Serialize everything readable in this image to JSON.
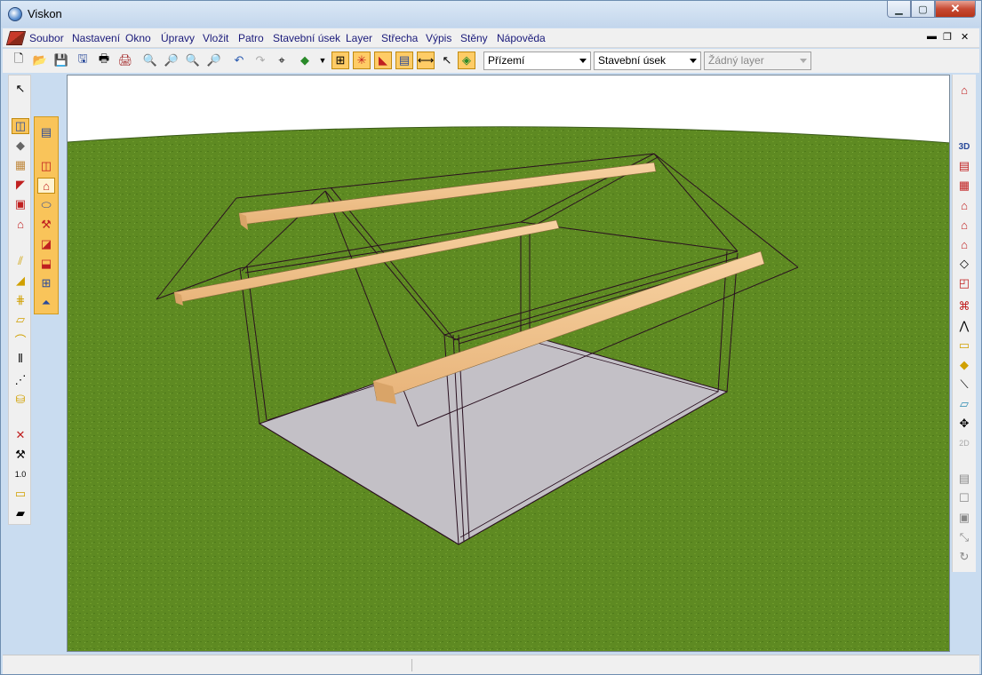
{
  "window": {
    "title": "Viskon"
  },
  "menu": {
    "items": [
      "Soubor",
      "Nastavení",
      "Okno",
      "Úpravy",
      "Vložit",
      "Patro",
      "Stavební úsek",
      "Layer",
      "Střecha",
      "Výpis",
      "Stěny",
      "Nápověda"
    ]
  },
  "toolbar": {
    "floor_select": "Přízemí",
    "section_select": "Stavební úsek",
    "layer_select": "Žádný layer"
  },
  "icons": {
    "toolbar": [
      "new-file-icon",
      "open-folder-icon",
      "save-icon",
      "save-all-icon",
      "print-icon",
      "print-preview-icon",
      "zoom-in-icon",
      "zoom-out-icon",
      "zoom-window-icon",
      "zoom-all-icon",
      "undo-icon",
      "redo-icon",
      "pan-icon",
      "3d-cube-icon",
      "grid-snap-icon",
      "snap-point-icon",
      "roof-icon",
      "hatch-icon",
      "dimension-icon",
      "pointer-icon",
      "layers-icon"
    ],
    "left": [
      "pointer-icon",
      "wall-icon",
      "slab-icon",
      "window-icon",
      "roof-icon",
      "column-icon",
      "house-icon",
      "line-icon",
      "stairs-icon",
      "railing-icon",
      "beam-icon",
      "arc-icon",
      "rafters-icon",
      "dotted-line-icon",
      "furniture-icon",
      "delete-icon",
      "tools-icon",
      "measure-icon",
      "ruler-icon",
      "beam-profile-icon"
    ],
    "right": [
      "house-view-icon",
      "3d-icon",
      "wall-view-icon",
      "building-icon",
      "roof-view-icon",
      "house-outline-icon",
      "home-icon",
      "eraser-icon",
      "frame-icon",
      "cat-icon",
      "node-icon",
      "rectangle-icon",
      "diamond-icon",
      "diagonal-icon",
      "panel-icon",
      "move-icon",
      "2d-icon",
      "stack-icon",
      "window-single-icon",
      "window-minimize-icon",
      "shrink-icon",
      "refresh-icon"
    ]
  },
  "colors": {
    "grass": "#5e8a22",
    "sky": "#ffffff",
    "beam": "#efc08a",
    "floor": "#c3c0c6",
    "wireframe": "#2a1020",
    "toolbar_active": "#f9c45a"
  }
}
